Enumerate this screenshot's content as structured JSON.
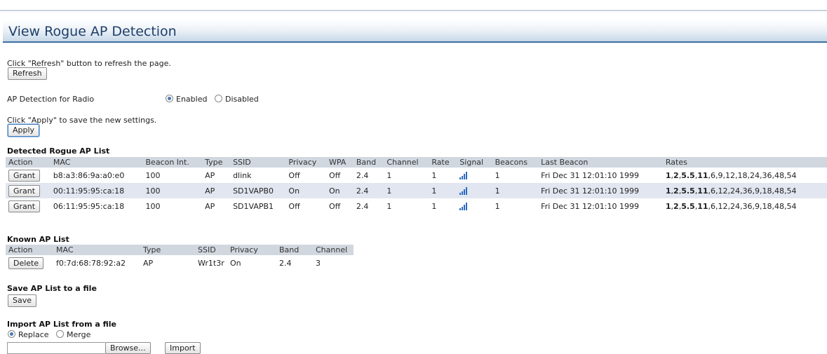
{
  "page": {
    "title": "View Rogue AP Detection"
  },
  "refresh": {
    "hint": "Click \"Refresh\" button to refresh the page.",
    "button": "Refresh"
  },
  "detection": {
    "label": "AP Detection for Radio",
    "enabled": "Enabled",
    "disabled": "Disabled",
    "selected": "Enabled"
  },
  "apply": {
    "hint": "Click \"Apply\" to save the new settings.",
    "button": "Apply"
  },
  "detected": {
    "heading": "Detected Rogue AP List",
    "columns": [
      "Action",
      "MAC",
      "Beacon Int.",
      "Type",
      "SSID",
      "Privacy",
      "WPA",
      "Band",
      "Channel",
      "Rate",
      "Signal",
      "Beacons",
      "Last Beacon",
      "Rates"
    ],
    "rows": [
      {
        "action": "Grant",
        "mac": "b8:a3:86:9a:a0:e0",
        "beacon_int": "100",
        "type": "AP",
        "ssid": "dlink",
        "privacy": "Off",
        "wpa": "Off",
        "band": "2.4",
        "channel": "1",
        "rate": "1",
        "signal_icon": "signal-bars-icon",
        "beacons": "1",
        "last_beacon": "Fri Dec 31 12:01:10 1999",
        "rates_bold": [
          "1",
          "2",
          "5.5",
          "11"
        ],
        "rates_rest": "6,9,12,18,24,36,48,54"
      },
      {
        "action": "Grant",
        "mac": "00:11:95:95:ca:18",
        "beacon_int": "100",
        "type": "AP",
        "ssid": "SD1VAPB0",
        "privacy": "On",
        "wpa": "On",
        "band": "2.4",
        "channel": "1",
        "rate": "1",
        "signal_icon": "signal-bars-icon",
        "beacons": "1",
        "last_beacon": "Fri Dec 31 12:01:10 1999",
        "rates_bold": [
          "1",
          "2",
          "5.5",
          "11"
        ],
        "rates_rest": "6,12,24,36,9,18,48,54"
      },
      {
        "action": "Grant",
        "mac": "06:11:95:95:ca:18",
        "beacon_int": "100",
        "type": "AP",
        "ssid": "SD1VAPB1",
        "privacy": "Off",
        "wpa": "Off",
        "band": "2.4",
        "channel": "1",
        "rate": "1",
        "signal_icon": "signal-bars-icon",
        "beacons": "1",
        "last_beacon": "Fri Dec 31 12:01:10 1999",
        "rates_bold": [
          "1",
          "2",
          "5.5",
          "11"
        ],
        "rates_rest": "6,12,24,36,9,18,48,54"
      }
    ]
  },
  "known": {
    "heading": "Known AP List",
    "columns": [
      "Action",
      "MAC",
      "Type",
      "SSID",
      "Privacy",
      "Band",
      "Channel"
    ],
    "rows": [
      {
        "action": "Delete",
        "mac": "f0:7d:68:78:92:a2",
        "type": "AP",
        "ssid": "Wr1t3r",
        "privacy": "On",
        "band": "2.4",
        "channel": "3"
      }
    ]
  },
  "save": {
    "heading": "Save AP List to a file",
    "button": "Save"
  },
  "import": {
    "heading": "Import AP List from a file",
    "replace": "Replace",
    "merge": "Merge",
    "selected": "Replace",
    "browse": "Browse...",
    "button": "Import"
  },
  "colors": {
    "title": "#1f3f6b",
    "header_bg": "#d0d7df",
    "alt_row": "#e1e6f0",
    "accent": "#3d6fa3"
  }
}
